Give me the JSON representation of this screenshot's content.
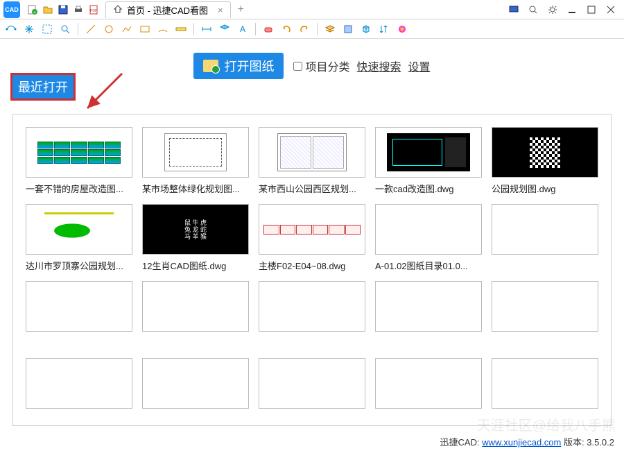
{
  "title": {
    "tab_label": "首页 - 迅捷CAD看图"
  },
  "recent_badge": "最近打开",
  "open_button": "打开图纸",
  "options": {
    "project_group": "项目分类",
    "quick_search": "快速搜索",
    "settings": "设置"
  },
  "files": [
    {
      "name": "一套不错的房屋改造图..."
    },
    {
      "name": "某市场整体绿化规划图..."
    },
    {
      "name": "某市西山公园西区规划..."
    },
    {
      "name": "一款cad改造图.dwg"
    },
    {
      "name": "公园规划图.dwg"
    },
    {
      "name": "达川市罗顶寨公园规划..."
    },
    {
      "name": "12生肖CAD图纸.dwg"
    },
    {
      "name": "主楼F02-E04~08.dwg"
    },
    {
      "name": "A-01.02图纸目录01.0..."
    },
    {
      "name": ""
    },
    {
      "name": ""
    },
    {
      "name": ""
    },
    {
      "name": ""
    },
    {
      "name": ""
    },
    {
      "name": ""
    },
    {
      "name": ""
    },
    {
      "name": ""
    },
    {
      "name": ""
    },
    {
      "name": ""
    },
    {
      "name": ""
    }
  ],
  "footer": {
    "brand": "迅捷CAD:",
    "url_text": "www.xunjiecad.com",
    "version_label": "版本:",
    "version": "3.5.0.2"
  },
  "watermark": "天涯社区@给我八手熊"
}
